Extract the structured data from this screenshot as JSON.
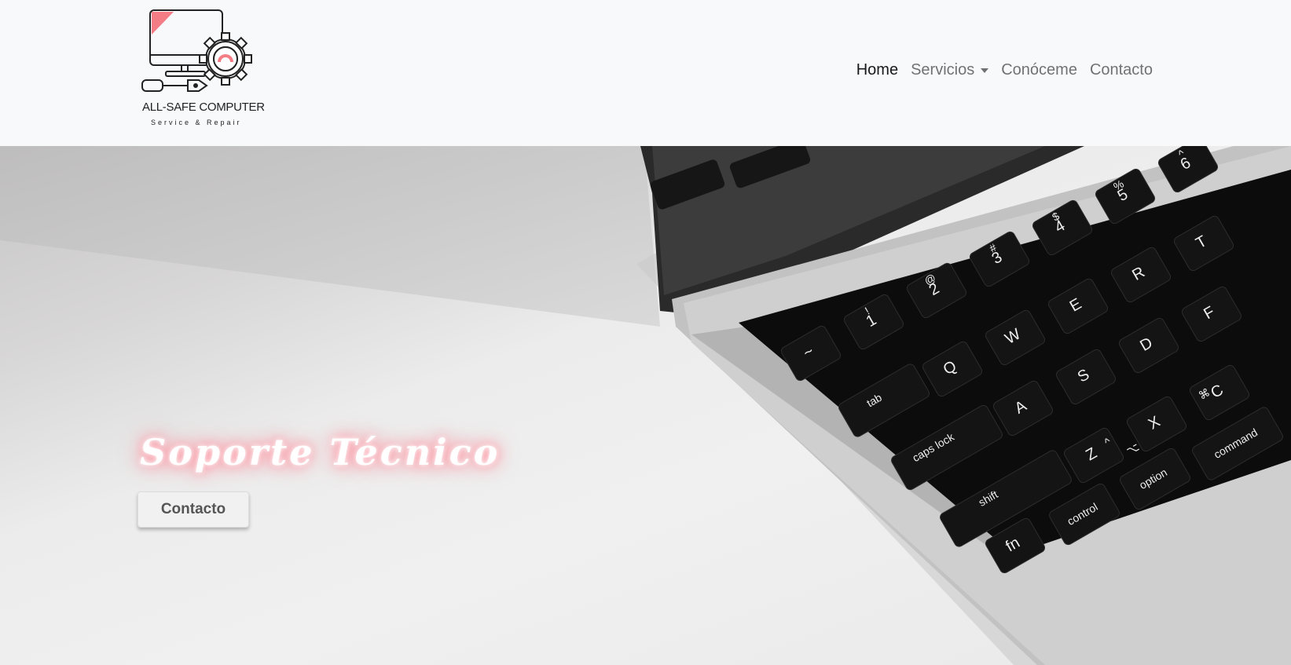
{
  "brand": {
    "name": "ALL-SAFE COMPUTER",
    "tagline": "Service & Repair",
    "accent_color": "#f47c85"
  },
  "nav": {
    "items": [
      {
        "label": "Home",
        "active": true
      },
      {
        "label": "Servicios",
        "dropdown": true
      },
      {
        "label": "Conóceme"
      },
      {
        "label": "Contacto"
      }
    ]
  },
  "hero": {
    "title": "Soporte Técnico",
    "button_label": "Contacto",
    "glow_color": "#ff8a98"
  },
  "keyboard": {
    "keys": [
      "~",
      "1",
      "2",
      "3",
      "4",
      "5",
      "6",
      "Q",
      "W",
      "E",
      "R",
      "T",
      "A",
      "S",
      "D",
      "F",
      "Z",
      "X",
      "C",
      "tab",
      "caps lock",
      "shift",
      "control",
      "option",
      "command",
      "fn"
    ],
    "symbols": [
      "!",
      "@",
      "#",
      "$",
      "%",
      "^",
      "⌥",
      "⌘",
      "^"
    ]
  }
}
